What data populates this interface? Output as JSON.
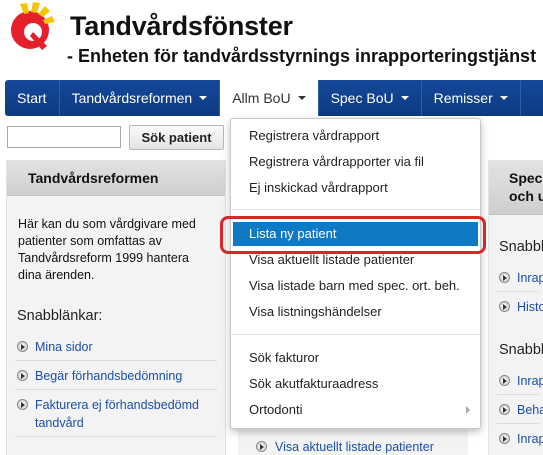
{
  "header": {
    "title": "Tandvårdsfönster",
    "subtitle": "- Enheten för tandvårdsstyrnings inrapporteringstjänst",
    "logo_colors": [
      "#e5202a",
      "#f7c400"
    ]
  },
  "nav": {
    "items": [
      {
        "label": "Start",
        "dropdown": false
      },
      {
        "label": "Tandvårdsreformen",
        "dropdown": true
      },
      {
        "label": "Allm BoU",
        "dropdown": true,
        "active": true
      },
      {
        "label": "Spec BoU",
        "dropdown": true
      },
      {
        "label": "Remisser",
        "dropdown": true
      }
    ]
  },
  "search": {
    "value": "",
    "button_label": "Sök patient"
  },
  "left_panel": {
    "title": "Tandvårdsreformen",
    "description": "Här kan du som vårdgivare med patienter som omfattas av Tandvårdsreform 1999 hantera dina ärenden.",
    "quick_links_title": "Snabblänkar:",
    "links": [
      "Mina sidor",
      "Begär förhandsbedömning",
      "Fakturera ej förhandsbedömd tandvård"
    ]
  },
  "mid_panel": {
    "link": "Visa aktuellt listade patienter"
  },
  "right_panel": {
    "title_line1": "Spec.",
    "title_line2": "och u",
    "quick_links_title": "Snabblän",
    "links": [
      "Inrap",
      "Histo"
    ],
    "quick_links_title2": "Snabblän",
    "links2": [
      "Inrap",
      "Beha",
      "Inrap"
    ]
  },
  "dropdown": {
    "group1": [
      "Registrera vårdrapport",
      "Registrera vårdrapporter via fil",
      "Ej inskickad vårdrapport"
    ],
    "group2": [
      "Lista ny patient",
      "Visa aktuellt listade patienter",
      "Visa listade barn med spec. ort. beh.",
      "Visa listningshändelser"
    ],
    "group3": [
      "Sök fakturor",
      "Sök akutfakturaadress",
      "Ortodonti"
    ],
    "highlighted_color": "#0e79c5",
    "annotation_color": "#d8262c"
  }
}
